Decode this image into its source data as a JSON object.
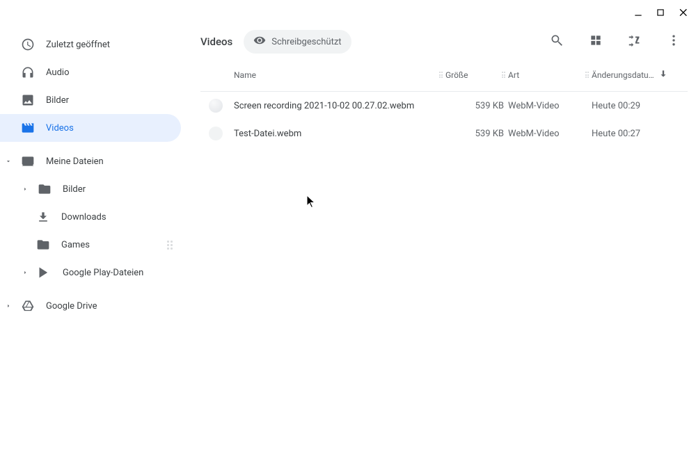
{
  "sidebar": {
    "items": [
      {
        "label": "Zuletzt geöffnet",
        "icon": "clock-icon"
      },
      {
        "label": "Audio",
        "icon": "headphones-icon"
      },
      {
        "label": "Bilder",
        "icon": "image-icon"
      },
      {
        "label": "Videos",
        "icon": "video-icon",
        "active": true
      }
    ],
    "myFiles": "Meine Dateien",
    "tree": [
      {
        "label": "Bilder"
      },
      {
        "label": "Downloads"
      },
      {
        "label": "Games"
      },
      {
        "label": "Google Play-Dateien"
      }
    ],
    "drive": "Google Drive"
  },
  "header": {
    "title": "Videos",
    "chip": "Schreibgeschützt"
  },
  "table": {
    "columns": {
      "name": "Name",
      "size": "Größe",
      "kind": "Art",
      "date": "Änderungsdatu…"
    },
    "rows": [
      {
        "name": "Screen recording 2021-10-02 00.27.02.webm",
        "size": "539 KB",
        "kind": "WebM-Video",
        "date": "Heute 00:29"
      },
      {
        "name": "Test-Datei.webm",
        "size": "539 KB",
        "kind": "WebM-Video",
        "date": "Heute 00:27"
      }
    ]
  }
}
